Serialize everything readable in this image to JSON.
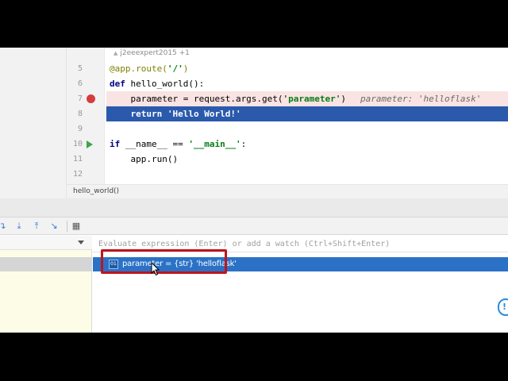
{
  "editor": {
    "author_annotation": "j2eeexpert2015 +1",
    "lines": [
      {
        "number": "5",
        "segments": [
          {
            "cls": "dec",
            "text": "@app.route("
          },
          {
            "cls": "str",
            "text": "'/'"
          },
          {
            "cls": "dec",
            "text": ")"
          }
        ]
      },
      {
        "number": "6",
        "segments": [
          {
            "cls": "kw",
            "text": "def "
          },
          {
            "cls": "fn",
            "text": "hello_world():"
          }
        ]
      },
      {
        "number": "7",
        "segments": [
          {
            "cls": "fn",
            "text": "    parameter = request.args.get("
          },
          {
            "cls": "str",
            "text": "'parameter'"
          },
          {
            "cls": "fn",
            "text": ")"
          }
        ]
      },
      {
        "number": "8",
        "segments": [
          {
            "cls": "kw",
            "text": "    return "
          },
          {
            "cls": "str",
            "text": "'Hello World!'"
          }
        ]
      },
      {
        "number": "9",
        "segments": []
      },
      {
        "number": "10",
        "segments": [
          {
            "cls": "kw",
            "text": "if "
          },
          {
            "cls": "fn",
            "text": "__name__ == "
          },
          {
            "cls": "str",
            "text": "'__main__'"
          },
          {
            "cls": "fn",
            "text": ":"
          }
        ]
      },
      {
        "number": "11",
        "segments": [
          {
            "cls": "fn",
            "text": "    app.run()"
          }
        ]
      },
      {
        "number": "12",
        "segments": []
      }
    ],
    "inline_hint": "parameter: 'helloflask'",
    "breadcrumb": "hello_world()"
  },
  "debug": {
    "toolbar_icons": [
      "step-over-icon",
      "step-into-icon",
      "step-out-icon",
      "run-to-cursor-icon",
      "evaluate-icon"
    ],
    "eval_placeholder": "Evaluate expression (Enter) or add a watch (Ctrl+Shift+Enter)",
    "variable": {
      "icon_label": "01",
      "text": "parameter = {str} 'helloflask'"
    }
  },
  "colors": {
    "execution_line": "#2b5aad",
    "breakpoint_line": "#fae3e3",
    "breakpoint": "#d63c3c",
    "selected_variable": "#2b72c6",
    "highlight_box": "#c0141c"
  }
}
